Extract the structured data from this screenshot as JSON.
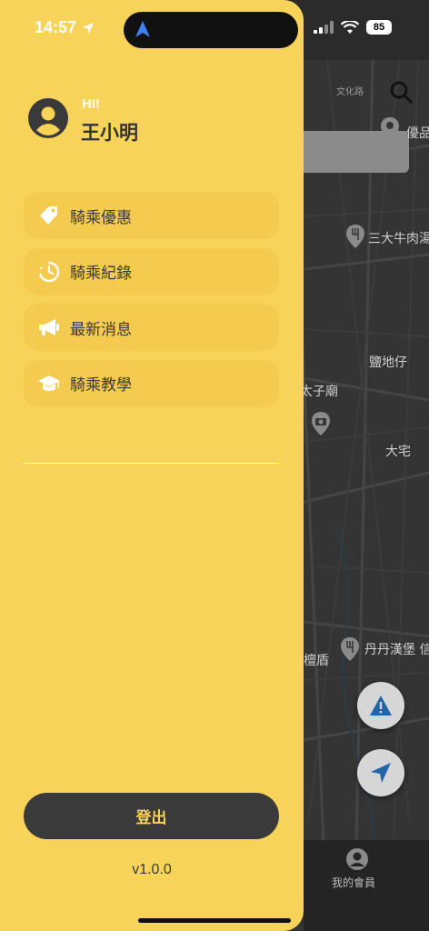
{
  "status_bar": {
    "time": "14:57",
    "battery": "85"
  },
  "user": {
    "greeting": "HI!",
    "name": "王小明"
  },
  "menu": {
    "items": [
      {
        "label": "騎乘優惠",
        "icon": "tag-icon"
      },
      {
        "label": "騎乘紀錄",
        "icon": "clock-history-icon"
      },
      {
        "label": "最新消息",
        "icon": "megaphone-icon"
      },
      {
        "label": "騎乘教學",
        "icon": "graduation-cap-icon"
      }
    ]
  },
  "logout_label": "登出",
  "version": "v1.0.0",
  "map": {
    "labels": [
      {
        "text": "優品"
      },
      {
        "text": "三大牛肉湯"
      },
      {
        "text": "鹽地仔"
      },
      {
        "text": "太子廟"
      },
      {
        "text": "大宅"
      },
      {
        "text": "丹丹漢堡 信"
      },
      {
        "text": "檀盾"
      },
      {
        "text": "文化路"
      }
    ],
    "member_label": "我的會員"
  },
  "colors": {
    "drawer": "#f8d35a",
    "menu_item": "#f4cb4e",
    "dark": "#3a3a3a",
    "map_bg": "#343434"
  }
}
